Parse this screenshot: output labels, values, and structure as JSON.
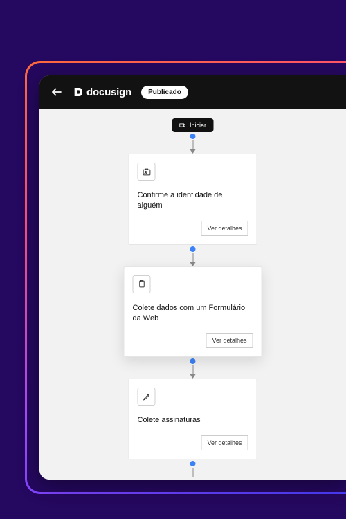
{
  "header": {
    "brand": "docusign",
    "status_badge": "Publicado"
  },
  "flow": {
    "start_label": "Iniciar",
    "steps": [
      {
        "title": "Confirme a identidade de alguém",
        "button": "Ver detalhes",
        "icon": "id-card-icon"
      },
      {
        "title": "Colete dados com um Formulário da Web",
        "button": "Ver detalhes",
        "icon": "clipboard-icon"
      },
      {
        "title": "Colete assinaturas",
        "button": "Ver detalhes",
        "icon": "pencil-icon"
      }
    ]
  }
}
